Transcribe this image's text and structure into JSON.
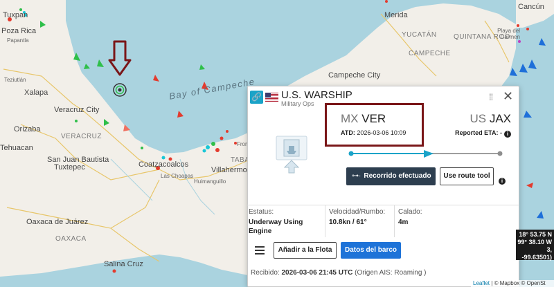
{
  "map": {
    "labels": {
      "tuxpan": "Tuxpan",
      "poza_rica": "Poza Rica",
      "papantla": "Papantla",
      "teziutlan": "Teziutlán",
      "xalapa": "Xalapa",
      "veracruz_city": "Veracruz City",
      "orizaba": "Orizaba",
      "veracruz_state": "VERACRUZ",
      "tehuacan": "Tehuacan",
      "san_juan_bautista": "San Juan Bautista",
      "tuxtepec": "Tuxtepec",
      "coatzacoalcos": "Coatzacoalcos",
      "las_choapas": "Las Choapas",
      "villahermosa": "Villahermosa",
      "huimanguillo": "Huimanguillo",
      "tabasco_abbr": "TABA",
      "frontera_abbr": "Fron",
      "oaxaca_city": "Oaxaca de Juárez",
      "oaxaca_state": "OAXACA",
      "salina_cruz": "Salina Cruz",
      "bay_of_campeche": "Bay of Campeche",
      "merida": "Merida",
      "campeche_city": "Campeche City",
      "cancun": "Cancún",
      "playa_del_carmen": "Playa del Carmen",
      "campeche_state": "CAMPECHE",
      "yucatan_state": "YUCATÁN",
      "quintana_roo": "QUINTANA ROO"
    }
  },
  "popup": {
    "ship_name": "U.S. WARSHIP",
    "ship_type": "Military Ops",
    "from_country": "MX",
    "from_port": "VER",
    "atd_label": "ATD:",
    "atd_value": "2026-03-06 10:09",
    "to_country": "US",
    "to_port": "JAX",
    "eta_label": "Reported ETA: -",
    "route_progress": 0.5,
    "btn_route_done": "Recorrido efectuado",
    "btn_route_tool": "Use route tool",
    "status_label": "Estatus:",
    "status_value": "Underway Using Engine",
    "speed_label": "Velocidad/Rumbo:",
    "speed_value": "10.8kn / 61°",
    "draught_label": "Calado:",
    "draught_value": "4m",
    "btn_add_fleet": "Añadir a la Flota",
    "btn_ship_data": "Datos del barco",
    "received_label": "Recibido:",
    "received_value": "2026-03-06 21:45 UTC",
    "received_origin": "(Origen AIS: Roaming )"
  },
  "coords": {
    "line1": "18° 53.75 N",
    "line2": "99° 38.10 W",
    "line3": "3, -99.63501)"
  },
  "attribution": {
    "leaflet": "Leaflet",
    "mapbox": "© Mapbox © OpenSt"
  },
  "colors": {
    "water": "#aad3df",
    "land": "#f2efe9",
    "accent_teal": "#1aa3c8",
    "highlight_box": "#7a1618",
    "button_dark": "#2d3e4f",
    "button_blue": "#1e73d8",
    "ship_red": "#e33b2e",
    "ship_green": "#2fbf4a",
    "ship_blue": "#1e6fd9",
    "ship_cyan": "#19c7d6"
  }
}
